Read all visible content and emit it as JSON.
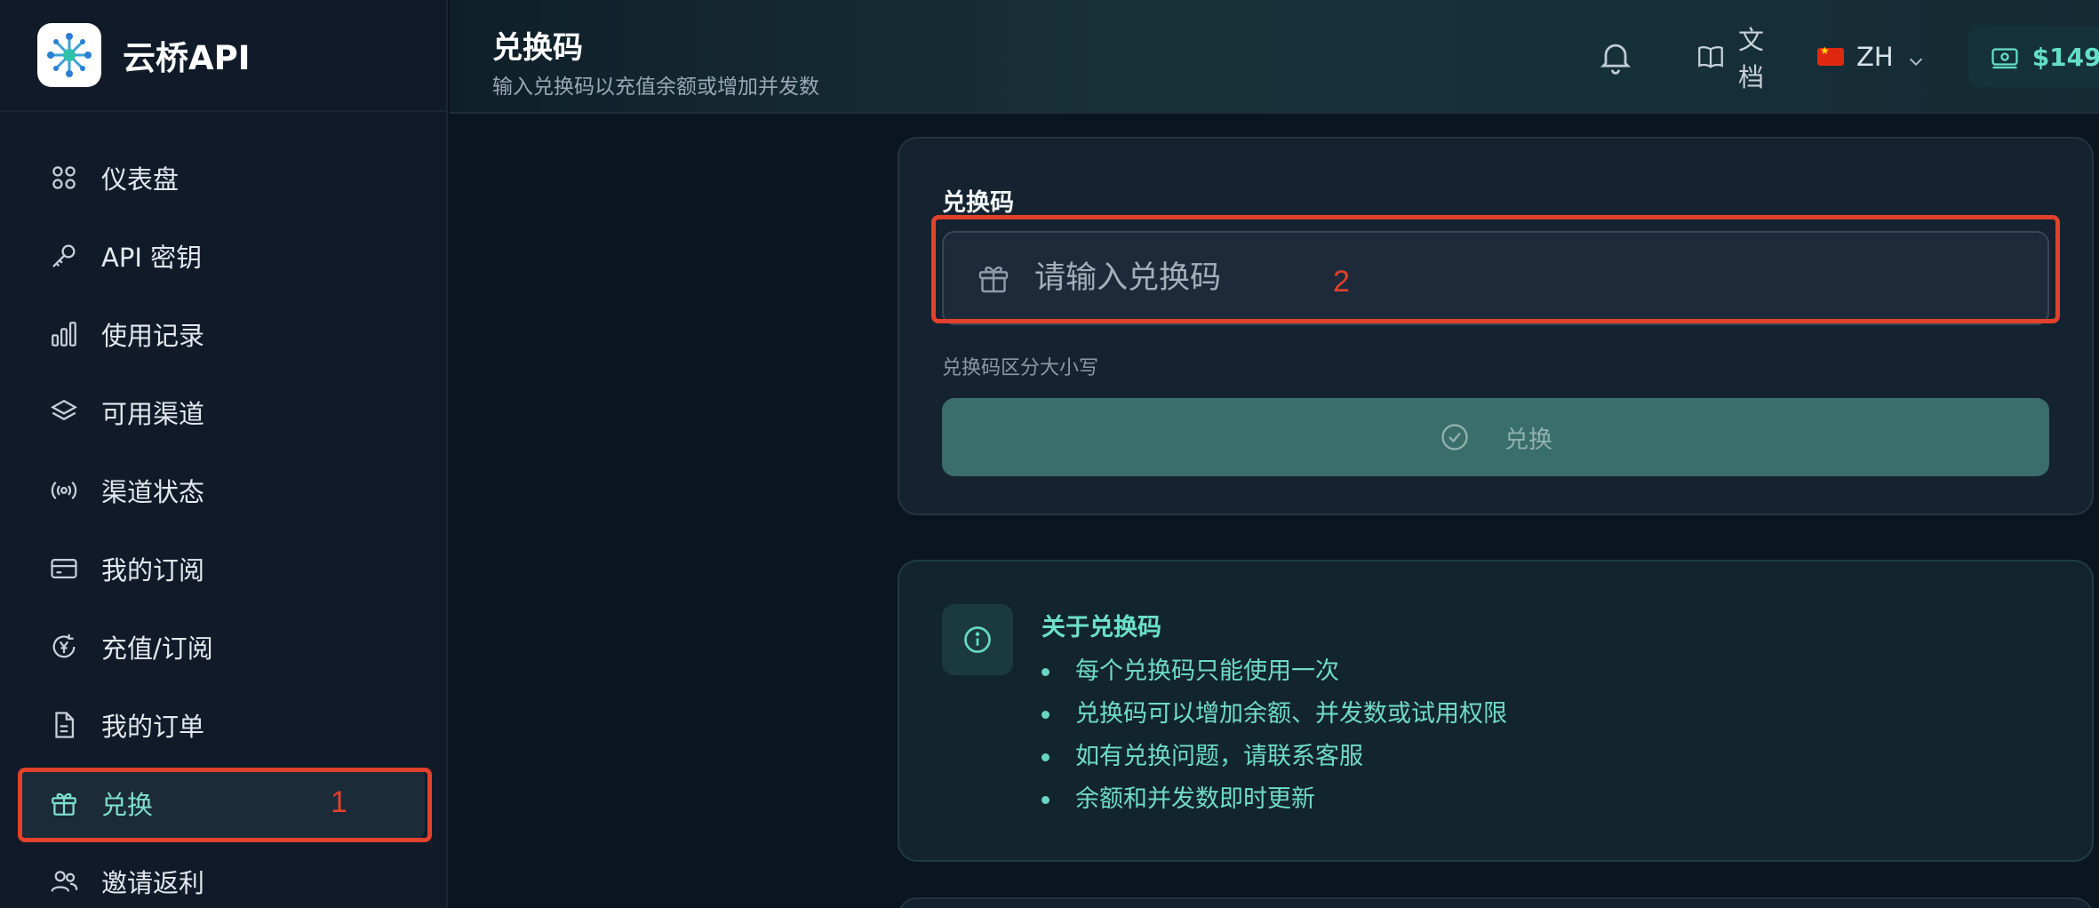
{
  "brand": {
    "name": "云桥API",
    "logo_icon": "network-hub-icon"
  },
  "sidebar": {
    "items": [
      {
        "label": "仪表盘",
        "icon": "grid-icon"
      },
      {
        "label": "API 密钥",
        "icon": "key-icon"
      },
      {
        "label": "使用记录",
        "icon": "bar-chart-icon"
      },
      {
        "label": "可用渠道",
        "icon": "layers-icon"
      },
      {
        "label": "渠道状态",
        "icon": "broadcast-icon"
      },
      {
        "label": "我的订阅",
        "icon": "card-icon"
      },
      {
        "label": "充值/订阅",
        "icon": "yuan-refresh-icon"
      },
      {
        "label": "我的订单",
        "icon": "document-icon"
      },
      {
        "label": "兑换",
        "icon": "gift-icon",
        "active": true
      },
      {
        "label": "邀请返利",
        "icon": "users-icon"
      }
    ],
    "annotation": "1"
  },
  "header": {
    "title": "兑换码",
    "subtitle": "输入兑换码以充值余额或增加并发数",
    "docs_label": "文档",
    "lang_label": "ZH",
    "balance_label": "$149"
  },
  "redeem": {
    "field_label": "兑换码",
    "placeholder": "请输入兑换码",
    "hint": "兑换码区分大小写",
    "button_label": "兑换",
    "annotation": "2"
  },
  "info": {
    "title": "关于兑换码",
    "items": [
      "每个兑换码只能使用一次",
      "兑换码可以增加余额、并发数或试用权限",
      "如有兑换问题，请联系客服",
      "余额和并发数即时更新"
    ]
  },
  "colors": {
    "accent": "#64dfc8",
    "annotation_red": "#e2412b",
    "sidebar_bg": "#101a28",
    "button_bg": "#3a6e6b"
  }
}
